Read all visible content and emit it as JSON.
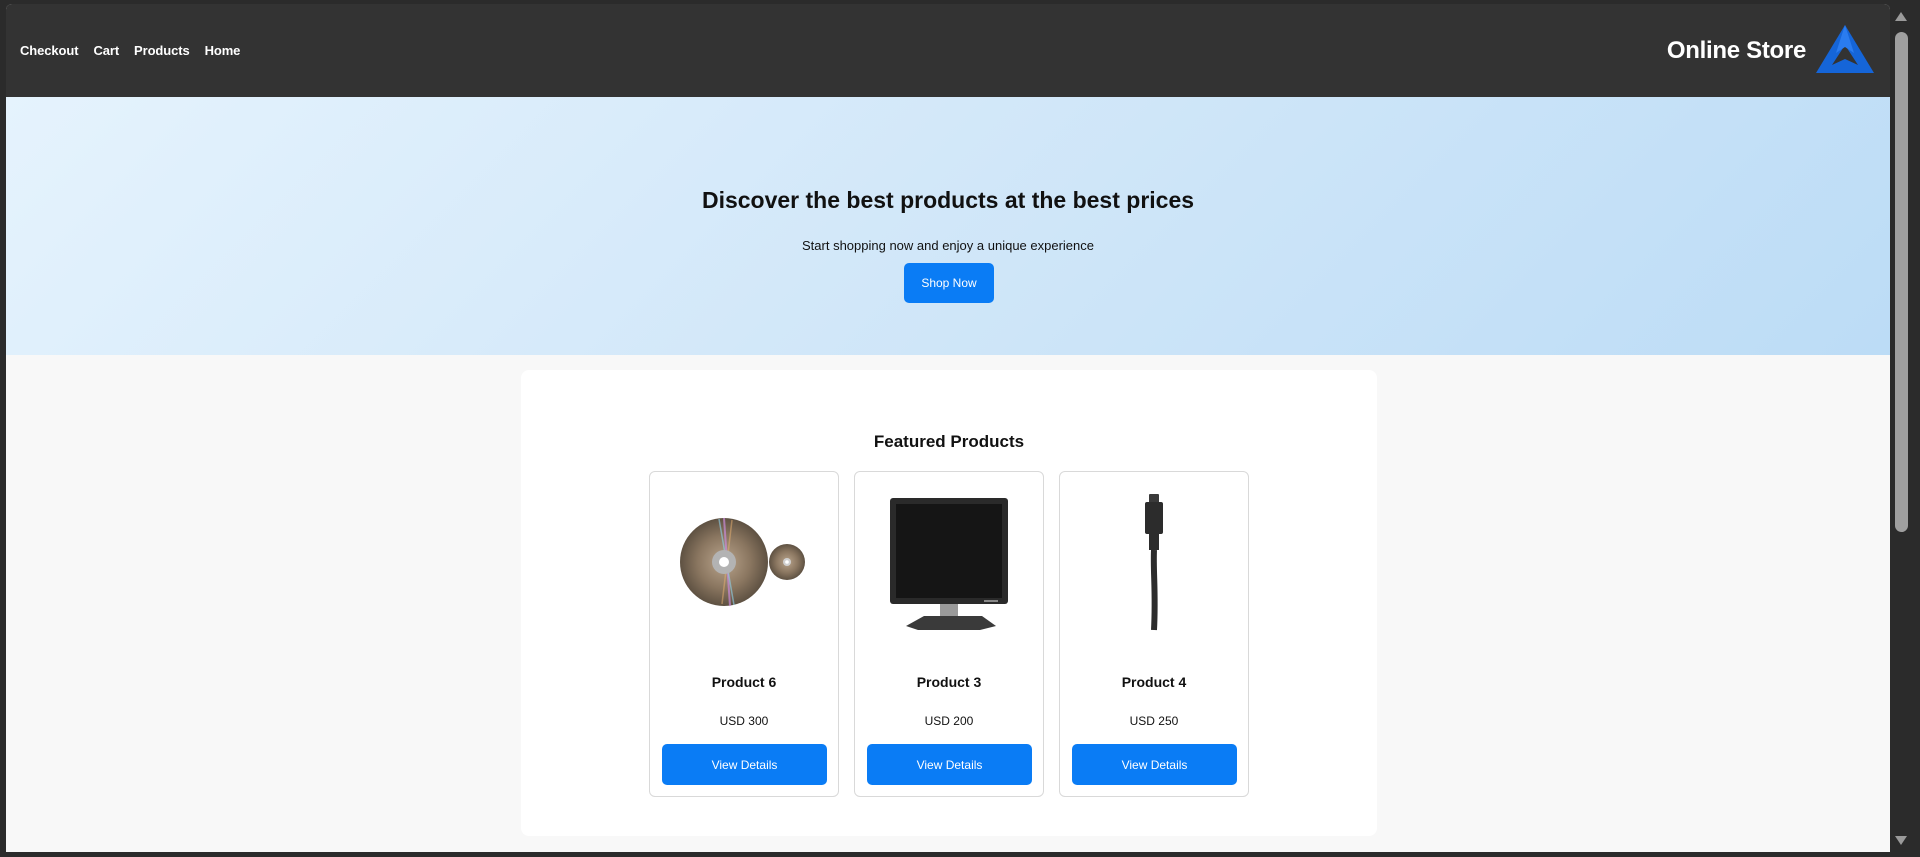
{
  "header": {
    "nav": [
      {
        "label": "Checkout"
      },
      {
        "label": "Cart"
      },
      {
        "label": "Products"
      },
      {
        "label": "Home"
      }
    ],
    "brand_name": "Online Store",
    "logo_icon": "triangle-star-logo",
    "bg_color": "#333333"
  },
  "hero": {
    "title": "Discover the best products at the best prices",
    "subtitle": "Start shopping now and enjoy a unique experience",
    "button_label": "Shop Now"
  },
  "featured": {
    "title": "Featured Products",
    "products": [
      {
        "name": "Product 6",
        "price": "USD 300",
        "button_label": "View Details",
        "image_icon": "disc-icon"
      },
      {
        "name": "Product 3",
        "price": "USD 200",
        "button_label": "View Details",
        "image_icon": "monitor-icon"
      },
      {
        "name": "Product 4",
        "price": "USD 250",
        "button_label": "View Details",
        "image_icon": "cable-icon"
      }
    ]
  },
  "colors": {
    "accent": "#0a7cf5",
    "logo": "#1565d8"
  }
}
